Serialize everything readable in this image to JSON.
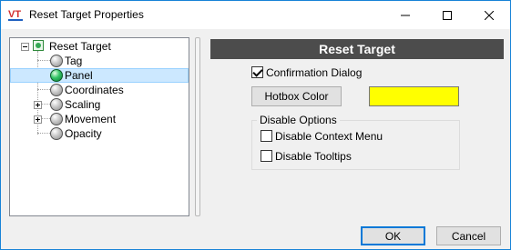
{
  "window": {
    "title": "Reset Target Properties",
    "logo_text": "VT",
    "accent": "#1883d7"
  },
  "tree": {
    "root": {
      "label": "Reset Target",
      "expanded": true
    },
    "items": [
      {
        "label": "Tag",
        "icon": "gray-ball-icon",
        "expander": "none",
        "selected": false
      },
      {
        "label": "Panel",
        "icon": "green-ball-icon",
        "expander": "none",
        "selected": true
      },
      {
        "label": "Coordinates",
        "icon": "gray-ball-icon",
        "expander": "none",
        "selected": false
      },
      {
        "label": "Scaling",
        "icon": "gray-ball-icon",
        "expander": "plus",
        "selected": false
      },
      {
        "label": "Movement",
        "icon": "gray-ball-icon",
        "expander": "plus",
        "selected": false
      },
      {
        "label": "Opacity",
        "icon": "gray-ball-icon",
        "expander": "none",
        "selected": false
      }
    ]
  },
  "panel": {
    "header": "Reset Target",
    "confirmation_dialog": {
      "label": "Confirmation Dialog",
      "checked": true
    },
    "hotbox": {
      "button_label": "Hotbox Color",
      "color": "#ffff00"
    },
    "disable_options": {
      "legend": "Disable Options",
      "context_menu": {
        "label": "Disable Context Menu",
        "checked": false
      },
      "tooltips": {
        "label": "Disable Tooltips",
        "checked": false
      }
    }
  },
  "footer": {
    "ok_label": "OK",
    "cancel_label": "Cancel"
  }
}
